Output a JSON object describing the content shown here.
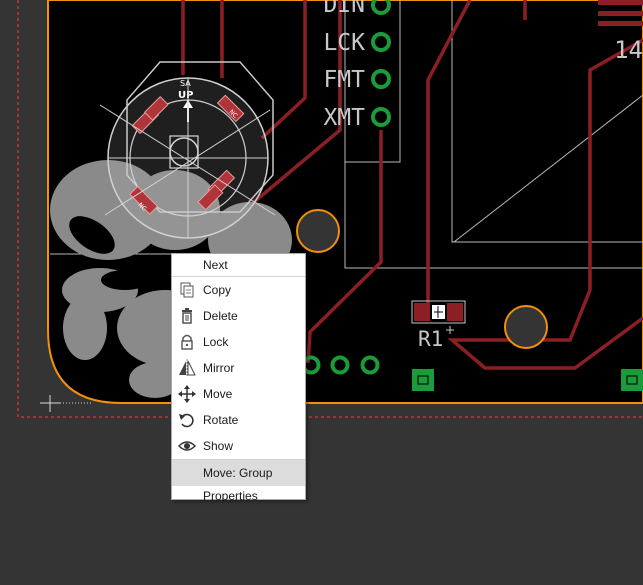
{
  "board": {
    "pin_labels": [
      "DIN",
      "LCK",
      "FMT",
      "XMT"
    ],
    "part_number": "14",
    "resistor_label": "R1",
    "badge": {
      "top": "SA",
      "main": "UP"
    },
    "small_label_1": "NC",
    "small_label_2": "NC",
    "colors": {
      "background": "#343434",
      "board_fill": "#000000",
      "copper": "#8b1f24",
      "board_outline": "#f0900c",
      "pad_green": "#1a9c3a",
      "silkscreen": "#c8c8c8",
      "dimension_line": "#e04040"
    }
  },
  "context_menu": {
    "items": [
      {
        "label": "Next",
        "icon": "none"
      },
      {
        "label": "Copy",
        "icon": "copy-icon"
      },
      {
        "label": "Delete",
        "icon": "trash-icon"
      },
      {
        "label": "Lock",
        "icon": "lock-icon"
      },
      {
        "label": "Mirror",
        "icon": "mirror-icon"
      },
      {
        "label": "Move",
        "icon": "move-icon"
      },
      {
        "label": "Rotate",
        "icon": "rotate-icon"
      },
      {
        "label": "Show",
        "icon": "eye-icon"
      },
      {
        "label": "Move: Group",
        "icon": "none"
      },
      {
        "label": "Properties",
        "icon": "none"
      }
    ],
    "highlighted": "Move: Group"
  }
}
